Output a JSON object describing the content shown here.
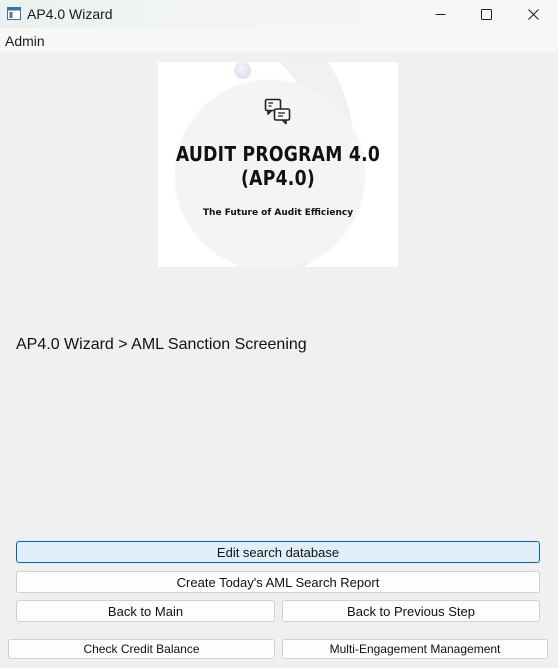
{
  "window": {
    "title": "AP4.0 Wizard",
    "controls": [
      "minimize",
      "maximize",
      "close"
    ]
  },
  "menubar": {
    "items": [
      {
        "label": "Admin"
      }
    ]
  },
  "logo": {
    "title_line1": "AUDIT PROGRAM 4.0",
    "title_line2": "(AP4.0)",
    "tagline": "The Future of Audit Efficiency",
    "icon": "chat-bubbles-icon"
  },
  "breadcrumb": "AP4.0 Wizard > AML Sanction Screening",
  "buttons": {
    "edit_search_database": "Edit search database",
    "create_report": "Create Today's AML Search Report",
    "back_to_main": "Back to Main",
    "back_to_previous": "Back to Previous Step",
    "check_credit_balance": "Check Credit Balance",
    "multi_engagement": "Multi-Engagement Management"
  },
  "colors": {
    "primary_button_border": "#0067c0",
    "primary_button_bg": "#e0eef9",
    "window_bg": "#f0f0f0"
  }
}
